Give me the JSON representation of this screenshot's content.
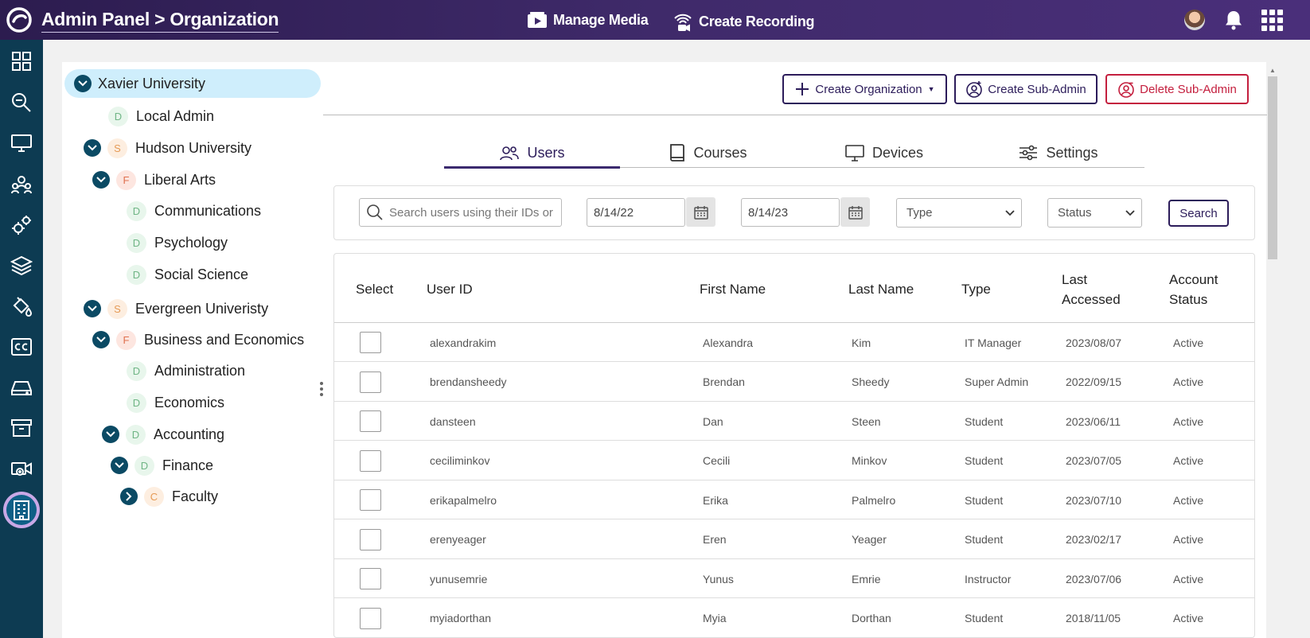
{
  "header": {
    "breadcrumb": "Admin Panel > Organization",
    "manage_media": "Manage Media",
    "create_recording": "Create Recording"
  },
  "tree": [
    {
      "label": "Xavier University",
      "badge": "",
      "expanded": true
    },
    {
      "label": "Local Admin",
      "badge": "D"
    },
    {
      "label": "Hudson University",
      "badge": "S"
    },
    {
      "label": "Liberal Arts",
      "badge": "F"
    },
    {
      "label": "Communications",
      "badge": "D"
    },
    {
      "label": "Psychology",
      "badge": "D"
    },
    {
      "label": "Social Science",
      "badge": "D"
    },
    {
      "label": "Evergreen Univeristy",
      "badge": "S"
    },
    {
      "label": "Business and Economics",
      "badge": "F"
    },
    {
      "label": "Administration",
      "badge": "D"
    },
    {
      "label": "Economics",
      "badge": "D"
    },
    {
      "label": "Accounting",
      "badge": "D"
    },
    {
      "label": "Finance",
      "badge": "D"
    },
    {
      "label": "Faculty",
      "badge": "C"
    }
  ],
  "actions": {
    "create_org": "Create Organization",
    "create_subadmin": "Create Sub-Admin",
    "delete_subadmin": "Delete Sub-Admin"
  },
  "tabs": [
    "Users",
    "Courses",
    "Devices",
    "Settings"
  ],
  "filters": {
    "search_placeholder": "Search users using their IDs or",
    "start_date": "8/14/22",
    "end_date": "8/14/23",
    "type": "Type",
    "status": "Status",
    "search_button": "Search"
  },
  "table": {
    "headers": {
      "select": "Select",
      "user_id": "User ID",
      "first": "First Name",
      "last": "Last Name",
      "type": "Type",
      "accessed_1": "Last",
      "accessed_2": "Accessed",
      "status_1": "Account",
      "status_2": "Status"
    },
    "rows": [
      {
        "user_id": "alexandrakim",
        "first": "Alexandra",
        "last": "Kim",
        "type": "IT Manager",
        "accessed": "2023/08/07",
        "status": "Active"
      },
      {
        "user_id": "brendansheedy",
        "first": "Brendan",
        "last": "Sheedy",
        "type": "Super Admin",
        "accessed": "2022/09/15",
        "status": "Active"
      },
      {
        "user_id": "dansteen",
        "first": "Dan",
        "last": "Steen",
        "type": "Student",
        "accessed": "2023/06/11",
        "status": "Active"
      },
      {
        "user_id": "ceciliminkov",
        "first": "Cecili",
        "last": "Minkov",
        "type": "Student",
        "accessed": "2023/07/05",
        "status": "Active"
      },
      {
        "user_id": "erikapalmelro",
        "first": "Erika",
        "last": "Palmelro",
        "type": "Student",
        "accessed": "2023/07/10",
        "status": "Active"
      },
      {
        "user_id": "erenyeager",
        "first": "Eren",
        "last": "Yeager",
        "type": "Student",
        "accessed": "2023/02/17",
        "status": "Active"
      },
      {
        "user_id": "yunusemrie",
        "first": "Yunus",
        "last": "Emrie",
        "type": "Instructor",
        "accessed": "2023/07/06",
        "status": "Active"
      },
      {
        "user_id": "myiadorthan",
        "first": "Myia",
        "last": "Dorthan",
        "type": "Student",
        "accessed": "2018/11/05",
        "status": "Active"
      }
    ]
  }
}
